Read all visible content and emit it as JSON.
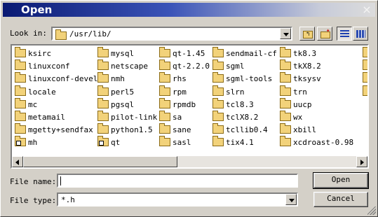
{
  "dialog": {
    "title": "Open",
    "close_glyph": "×"
  },
  "look_in": {
    "label": "Look in:",
    "path": "/usr/lib/"
  },
  "toolbar": {
    "icons": [
      "folder-up-icon",
      "new-folder-icon",
      "list-view-icon",
      "detail-view-icon"
    ]
  },
  "files": {
    "columns": [
      [
        "ksirc",
        "linuxconf",
        "linuxconf-devel",
        "locale",
        "mc",
        "metamail",
        "mgetty+sendfax",
        "mh"
      ],
      [
        "mysql",
        "netscape",
        "nmh",
        "perl5",
        "pgsql",
        "pilot-link",
        "python1.5",
        "qt"
      ],
      [
        "qt-1.45",
        "qt-2.2.0",
        "rhs",
        "rpm",
        "rpmdb",
        "sa",
        "sane",
        "sasl"
      ],
      [
        "sendmail-cf",
        "sgml",
        "sgml-tools",
        "slrn",
        "tcl8.3",
        "tclX8.2",
        "tcllib0.4",
        "tix4.1"
      ],
      [
        "tk8.3",
        "tkX8.2",
        "tksysv",
        "trn",
        "uucp",
        "wx",
        "xbill",
        "xcdroast-0.98"
      ]
    ],
    "links": [
      "mh",
      "qt"
    ]
  },
  "file_name": {
    "label": "File name:",
    "value": ""
  },
  "file_type": {
    "label": "File type:",
    "value": "*.h"
  },
  "buttons": {
    "open": "Open",
    "cancel": "Cancel"
  }
}
